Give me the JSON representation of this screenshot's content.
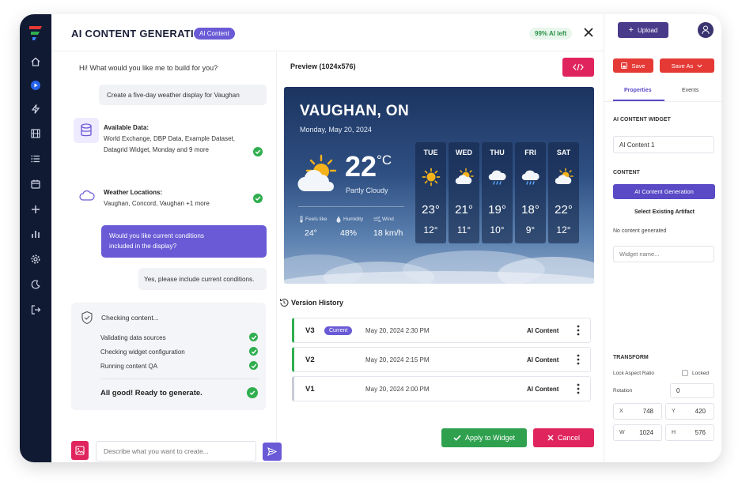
{
  "modal": {
    "title": "AI CONTENT GENERATION",
    "badge": "AI Content",
    "ai_left": "99% AI left"
  },
  "chat": {
    "greeting": "Hi! What would you like me to build for you?",
    "user_prompt": "Create a five-day weather display for Vaughan",
    "data_title": "Available Data:",
    "data_line1": "World Exchange, DBP Data, Example Dataset,",
    "data_line2": "Datagrid Widget, Monday and 9 more",
    "loc_title": "Weather Locations:",
    "loc_value": "Vaughan, Concord, Vaughan +1 more",
    "ai_question_line1": "Would you like current conditions",
    "ai_question_line2": "included in the display?",
    "user_reply": "Yes, please include current conditions.",
    "checking_title": "Checking content...",
    "checks": [
      "Validating data sources",
      "Checking widget configuration",
      "Running content QA"
    ],
    "ready": "All good! Ready to generate.",
    "input_placeholder": "Describe what you want to create..."
  },
  "preview": {
    "label": "Preview (1024x576)",
    "weather": {
      "city": "VAUGHAN, ON",
      "date": "Monday, May 20, 2024",
      "temp": "22",
      "unit": "°C",
      "condition": "Partly Cloudy",
      "feels_label": "Feels like",
      "humidity_label": "Humidity",
      "wind_label": "Wind",
      "feels": "24°",
      "humidity": "48%",
      "wind": "18 km/h",
      "days": [
        {
          "name": "TUE",
          "hi": "23°",
          "lo": "12°",
          "icon": "sun-icon"
        },
        {
          "name": "WED",
          "hi": "21°",
          "lo": "11°",
          "icon": "partly-cloudy-icon"
        },
        {
          "name": "THU",
          "hi": "19°",
          "lo": "10°",
          "icon": "rain-cloud-icon"
        },
        {
          "name": "FRI",
          "hi": "18°",
          "lo": "9°",
          "icon": "rain-cloud-icon"
        },
        {
          "name": "SAT",
          "hi": "22°",
          "lo": "12°",
          "icon": "partly-cloudy-icon"
        }
      ]
    }
  },
  "versions": {
    "title": "Version History",
    "current_label": "Current",
    "items": [
      {
        "name": "V3",
        "date": "May 20, 2024 2:30 PM",
        "type": "AI Content"
      },
      {
        "name": "V2",
        "date": "May 20, 2024 2:15 PM",
        "type": "AI Content"
      },
      {
        "name": "V1",
        "date": "May 20, 2024 2:00 PM",
        "type": "AI Content"
      }
    ]
  },
  "actions": {
    "apply": "Apply to Widget",
    "cancel": "Cancel"
  },
  "right_panel": {
    "upload": "Upload",
    "save": "Save",
    "save_as": "Save As",
    "tab_properties": "Properties",
    "tab_events": "Events",
    "widget_section": "AI CONTENT WIDGET",
    "widget_name": "AI Content 1",
    "content_section": "CONTENT",
    "ai_button": "AI Content Generation",
    "select_artifact": "Select Existing Artifact",
    "no_content": "No content generated",
    "name_placeholder": "Widget name...",
    "transform_section": "TRANSFORM",
    "lock_label": "Lock Aspect Ratio",
    "locked": "Locked",
    "rotation_label": "Rotation",
    "rotation": "0",
    "x_label": "X",
    "x": "748",
    "y_label": "Y",
    "y": "420",
    "w_label": "W",
    "w": "1024",
    "h_label": "H",
    "h": "576"
  },
  "colors": {
    "sidebar": "#101a33",
    "accent_purple": "#6a5ad6",
    "success_green": "#2fae4f",
    "danger_red": "#e0245e",
    "save_red": "#e53935"
  }
}
